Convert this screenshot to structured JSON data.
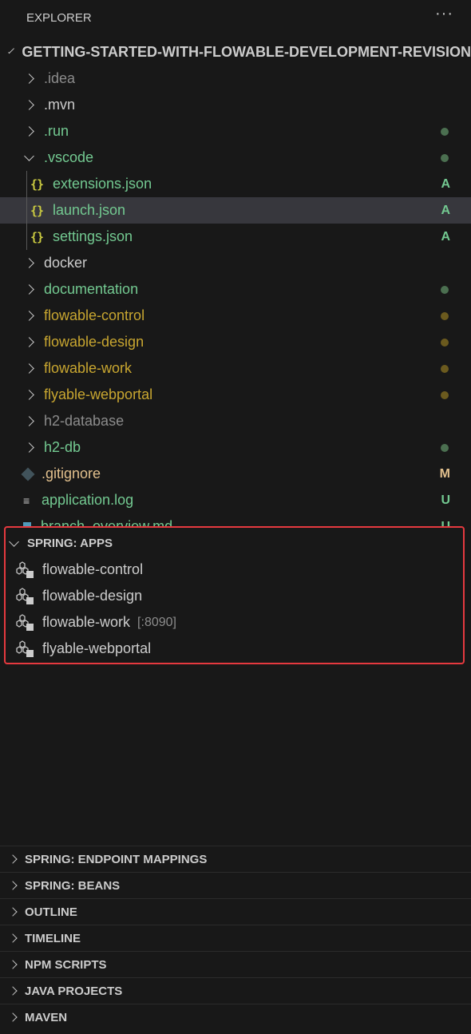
{
  "header": {
    "title": "EXPLORER",
    "more": "···"
  },
  "project": {
    "title": "GETTING-STARTED-WITH-FLOWABLE-DEVELOPMENT-REVISION"
  },
  "tree": [
    {
      "label": ".idea",
      "type": "folder",
      "color": "#8c8c8c",
      "status": ""
    },
    {
      "label": ".mvn",
      "type": "folder",
      "color": "#cccccc",
      "status": ""
    },
    {
      "label": ".run",
      "type": "folder",
      "color": "#73c991",
      "status": "dot",
      "statusColor": "#4b6f50"
    },
    {
      "label": ".vscode",
      "type": "folder-open",
      "color": "#73c991",
      "status": "dot",
      "statusColor": "#4b6f50"
    },
    {
      "label": "extensions.json",
      "type": "json",
      "color": "#73c991",
      "status": "A",
      "statusColor": "#73c991"
    },
    {
      "label": "launch.json",
      "type": "json",
      "color": "#73c991",
      "status": "A",
      "statusColor": "#73c991"
    },
    {
      "label": "settings.json",
      "type": "json",
      "color": "#73c991",
      "status": "A",
      "statusColor": "#73c991"
    },
    {
      "label": "docker",
      "type": "folder",
      "color": "#cccccc",
      "status": ""
    },
    {
      "label": "documentation",
      "type": "folder",
      "color": "#73c991",
      "status": "dot",
      "statusColor": "#4b6f50"
    },
    {
      "label": "flowable-control",
      "type": "folder",
      "color": "#c8a630",
      "status": "dot",
      "statusColor": "#6b5a1e"
    },
    {
      "label": "flowable-design",
      "type": "folder",
      "color": "#c8a630",
      "status": "dot",
      "statusColor": "#6b5a1e"
    },
    {
      "label": "flowable-work",
      "type": "folder",
      "color": "#c8a630",
      "status": "dot",
      "statusColor": "#6b5a1e"
    },
    {
      "label": "flyable-webportal",
      "type": "folder",
      "color": "#c8a630",
      "status": "dot",
      "statusColor": "#6b5a1e"
    },
    {
      "label": "h2-database",
      "type": "folder",
      "color": "#8c8c8c",
      "status": ""
    },
    {
      "label": "h2-db",
      "type": "folder",
      "color": "#73c991",
      "status": "dot",
      "statusColor": "#4b6f50"
    },
    {
      "label": ".gitignore",
      "type": "git",
      "color": "#e2c08d",
      "status": "M",
      "statusColor": "#e2c08d"
    },
    {
      "label": "application.log",
      "type": "log",
      "color": "#73c991",
      "status": "U",
      "statusColor": "#73c991"
    },
    {
      "label": "branch_overview.md",
      "type": "md",
      "color": "#73c991",
      "status": "U",
      "statusColor": "#73c991"
    }
  ],
  "spring_apps": {
    "title": "SPRING: APPS",
    "apps": [
      {
        "name": "flowable-control",
        "port": ""
      },
      {
        "name": "flowable-design",
        "port": ""
      },
      {
        "name": "flowable-work",
        "port": "[:8090]"
      },
      {
        "name": "flyable-webportal",
        "port": ""
      }
    ]
  },
  "sections": [
    "SPRING: ENDPOINT MAPPINGS",
    "SPRING: BEANS",
    "OUTLINE",
    "TIMELINE",
    "NPM SCRIPTS",
    "JAVA PROJECTS",
    "MAVEN"
  ]
}
